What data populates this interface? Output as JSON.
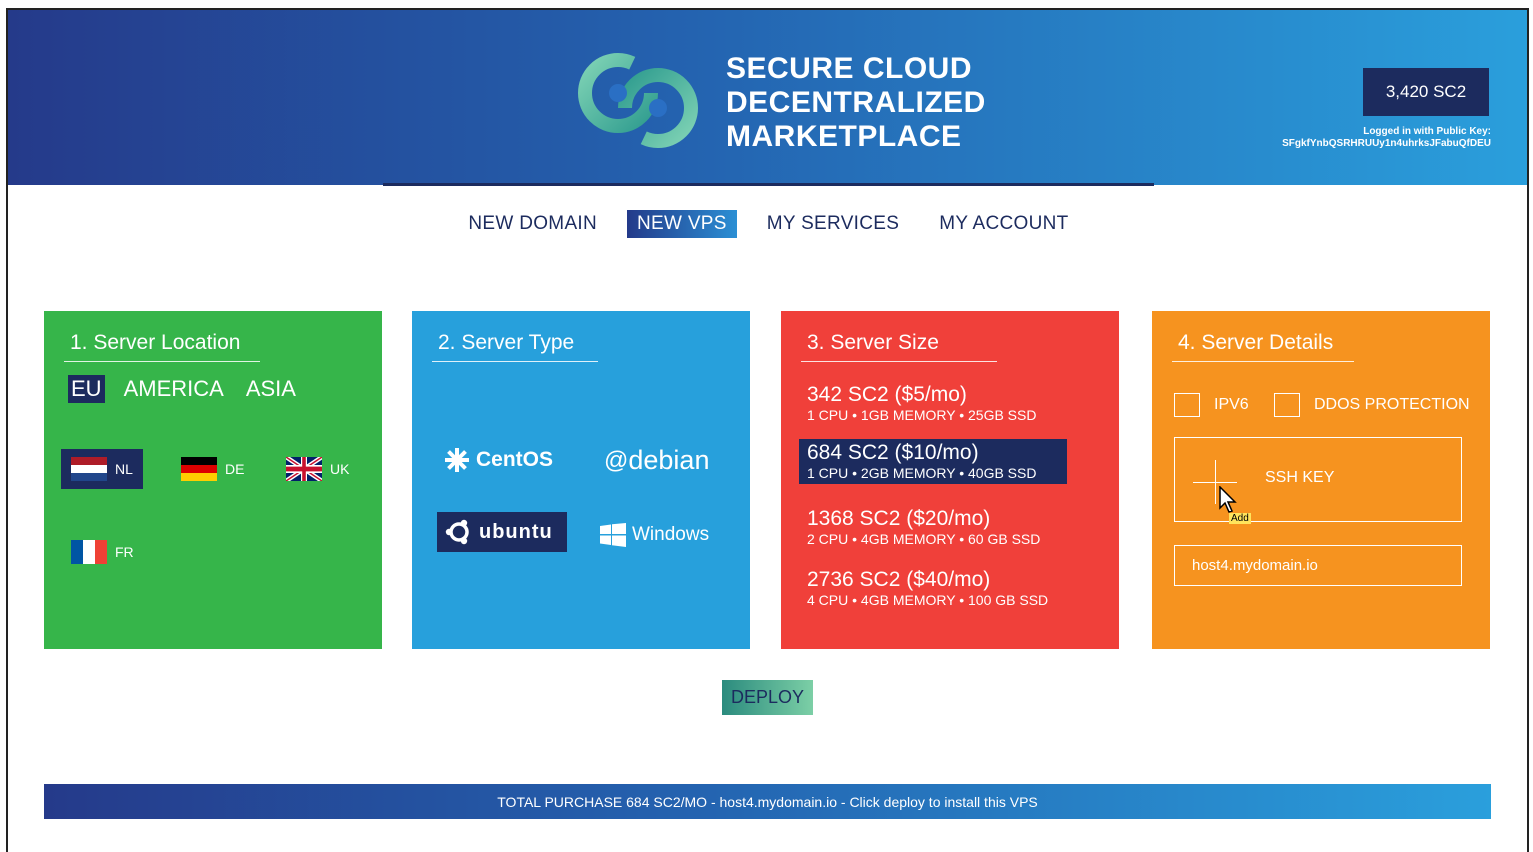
{
  "header": {
    "brand_line1": "SECURE CLOUD",
    "brand_line2": "DECENTRALIZED",
    "brand_line3": "MARKETPLACE",
    "balance": "3,420 SC2",
    "login_label": "Logged in with Public Key:",
    "public_key": "SFgkfYnbQSRHRUUy1n4uhrksJFabuQfDEU"
  },
  "nav": {
    "items": [
      "NEW DOMAIN",
      "NEW VPS",
      "MY SERVICES",
      "MY ACCOUNT"
    ],
    "active": "NEW VPS"
  },
  "location": {
    "title": "1. Server Location",
    "regions": [
      "EU",
      "AMERICA",
      "ASIA"
    ],
    "active_region": "EU",
    "countries": [
      "NL",
      "DE",
      "UK",
      "FR"
    ],
    "selected_country": "NL"
  },
  "server_type": {
    "title": "2. Server Type",
    "os": [
      "CentOS",
      "debian",
      "ubuntu",
      "Windows"
    ],
    "selected_os": "ubuntu"
  },
  "server_size": {
    "title": "3. Server Size",
    "options": [
      {
        "price": "342 SC2 ($5/mo)",
        "spec": "1 CPU • 1GB MEMORY • 25GB SSD"
      },
      {
        "price": "684 SC2 ($10/mo)",
        "spec": "1 CPU • 2GB MEMORY • 40GB SSD"
      },
      {
        "price": "1368 SC2 ($20/mo)",
        "spec": "2 CPU • 4GB MEMORY • 60 GB SSD"
      },
      {
        "price": "2736 SC2 ($40/mo)",
        "spec": "4 CPU • 4GB MEMORY • 100 GB SSD"
      }
    ],
    "selected": "684 SC2 ($10/mo)"
  },
  "server_details": {
    "title": "4. Server Details",
    "ipv6_label": "IPV6",
    "ddos_label": "DDOS PROTECTION",
    "ssh_label": "SSH KEY",
    "add_tooltip": "Add",
    "hostname_value": "host4.mydomain.io"
  },
  "deploy_label": "DEPLOY",
  "footer_text": "TOTAL PURCHASE 684 SC2/MO - host4.mydomain.io - Click deploy to install this VPS",
  "colors": {
    "navy": "#1c2b5e",
    "location_green": "#36b54a",
    "type_blue": "#27a0dc",
    "size_red": "#f0403a",
    "details_orange": "#f6931f"
  }
}
